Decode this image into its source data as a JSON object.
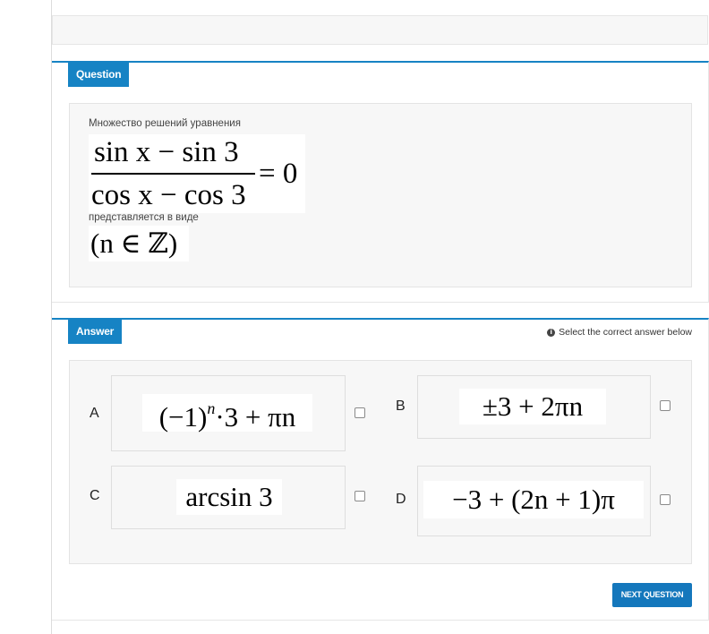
{
  "question": {
    "tag": "Question",
    "prompt": "Множество решений уравнения",
    "equation": {
      "numerator": "sin x − sin 3",
      "denominator": "cos x − cos 3",
      "equals": "= 0"
    },
    "middle_text": "представляется в виде",
    "domain_note": "(n ∈ ℤ)"
  },
  "answer": {
    "tag": "Answer",
    "hint": "Select the correct answer below",
    "options": [
      {
        "letter": "A",
        "base": "(−1)",
        "sup": "n",
        "rest": "·3  + πn"
      },
      {
        "letter": "B",
        "formula": "±3  +  2πn"
      },
      {
        "letter": "C",
        "formula": "arcsin 3"
      },
      {
        "letter": "D",
        "formula": "−3  +  (2n +  1)π"
      }
    ]
  },
  "next_button": "NEXT QUESTION",
  "colors": {
    "accent": "#1683c4",
    "button": "#1477bc",
    "box_bg": "#f7f7f7"
  }
}
